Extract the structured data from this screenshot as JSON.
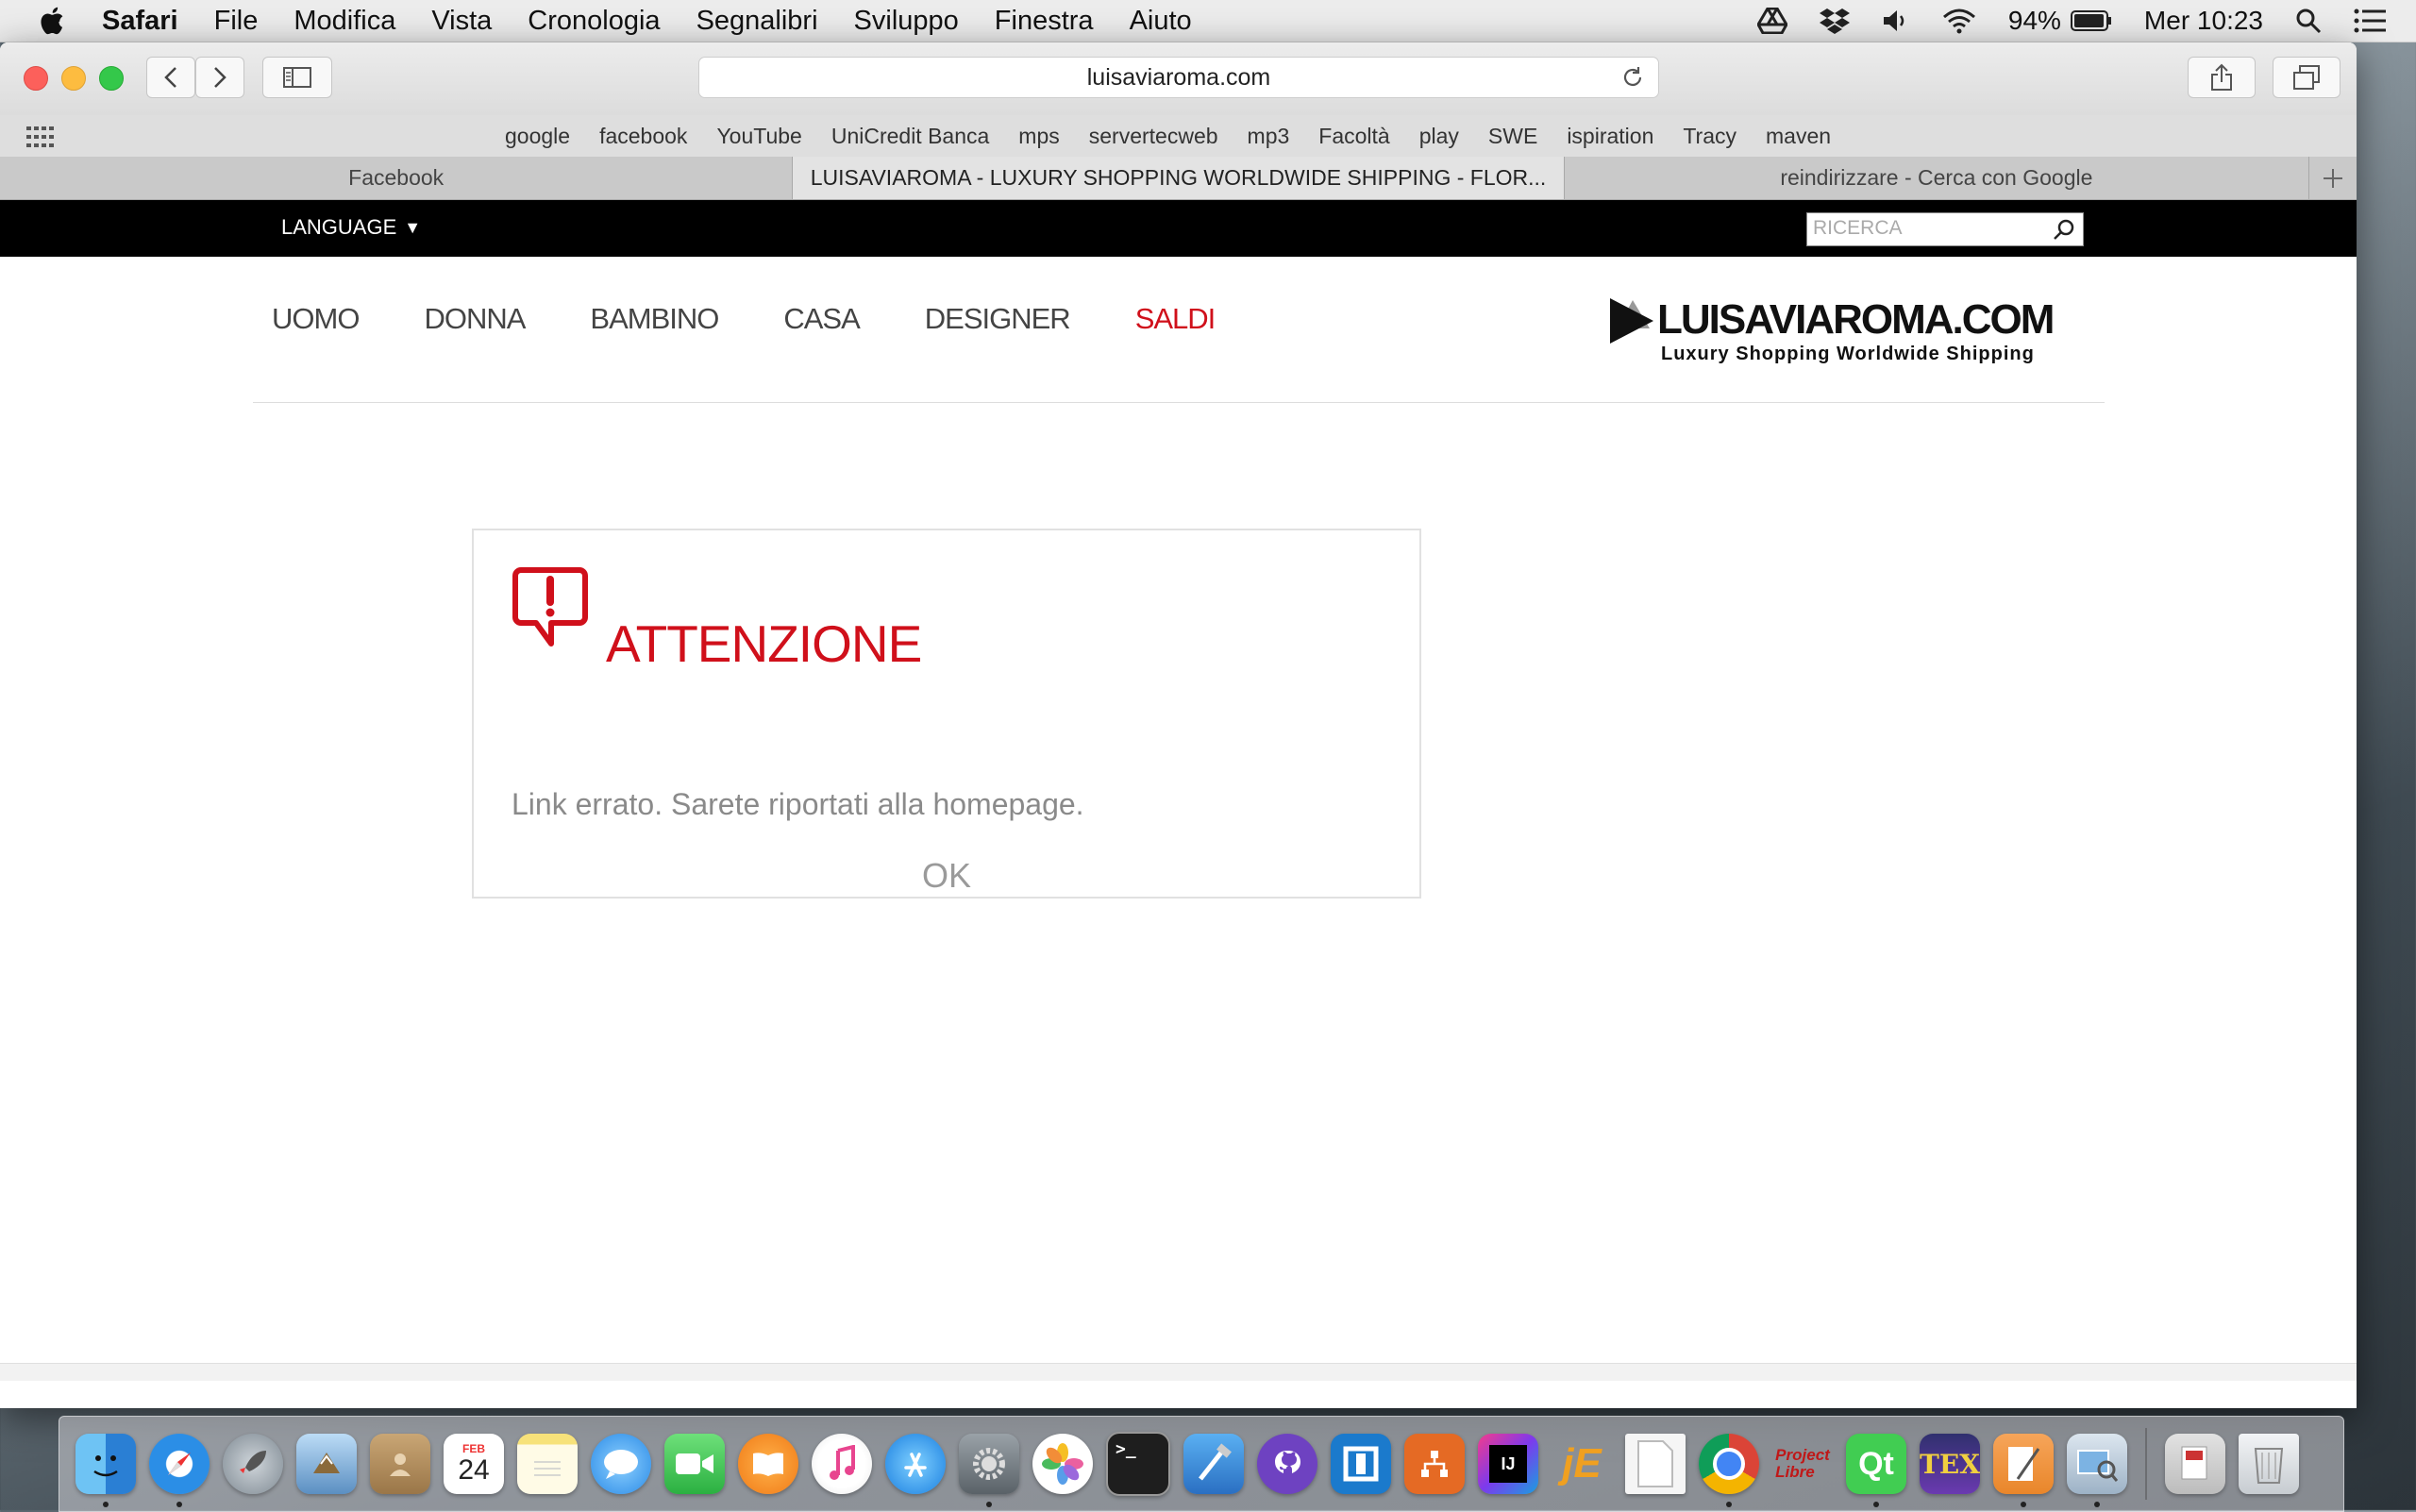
{
  "menubar": {
    "app_name": "Safari",
    "menus": [
      "File",
      "Modifica",
      "Vista",
      "Cronologia",
      "Segnalibri",
      "Sviluppo",
      "Finestra",
      "Aiuto"
    ],
    "battery": "94%",
    "clock": "Mer 10:23",
    "status_icons": [
      "google-drive-icon",
      "dropbox-icon",
      "volume-icon",
      "wifi-icon",
      "battery-icon",
      "spotlight-icon",
      "notification-center-icon"
    ]
  },
  "browser": {
    "url": "luisaviaroma.com",
    "bookmarks": [
      "google",
      "facebook",
      "YouTube",
      "UniCredit Banca",
      "mps",
      "servertecweb",
      "mp3",
      "Facoltà",
      "play",
      "SWE",
      "ispiration",
      "Tracy",
      "maven"
    ],
    "tabs": [
      {
        "title": "Facebook",
        "active": false
      },
      {
        "title": "LUISAVIAROMA - LUXURY SHOPPING WORLDWIDE SHIPPING - FLOR...",
        "active": true
      },
      {
        "title": "reindirizzare - Cerca con Google",
        "active": false
      }
    ]
  },
  "site": {
    "language_label": "LANGUAGE",
    "search_placeholder": "RICERCA",
    "nav": [
      "UOMO",
      "DONNA",
      "BAMBINO",
      "CASA",
      "DESIGNER",
      "SALDI"
    ],
    "logo_main": "LUISAVIAROMA.COM",
    "logo_sub": "Luxury Shopping Worldwide Shipping",
    "accent_color": "#d0101b"
  },
  "dialog": {
    "title": "ATTENZIONE",
    "message": "Link errato. Sarete riportati alla homepage.",
    "ok_label": "OK"
  },
  "dock": {
    "apps": [
      "Finder",
      "Safari",
      "Launchpad",
      "Mail",
      "Contacts",
      "Calendar",
      "Notes",
      "Messages",
      "FaceTime",
      "iBooks",
      "iTunes",
      "App Store",
      "System Preferences",
      "Photos",
      "Terminal",
      "Xcode",
      "GitHub Desktop",
      "Visual Studio Code",
      "SourceTree",
      "IntelliJ IDEA",
      "jEdit",
      "TextEdit",
      "Google Chrome",
      "ProjectLibre",
      "Qt Creator",
      "TeXShop",
      "Pages",
      "Preview",
      "Downloads",
      "Trash"
    ],
    "calendar_month": "FEB",
    "calendar_day": "24"
  }
}
